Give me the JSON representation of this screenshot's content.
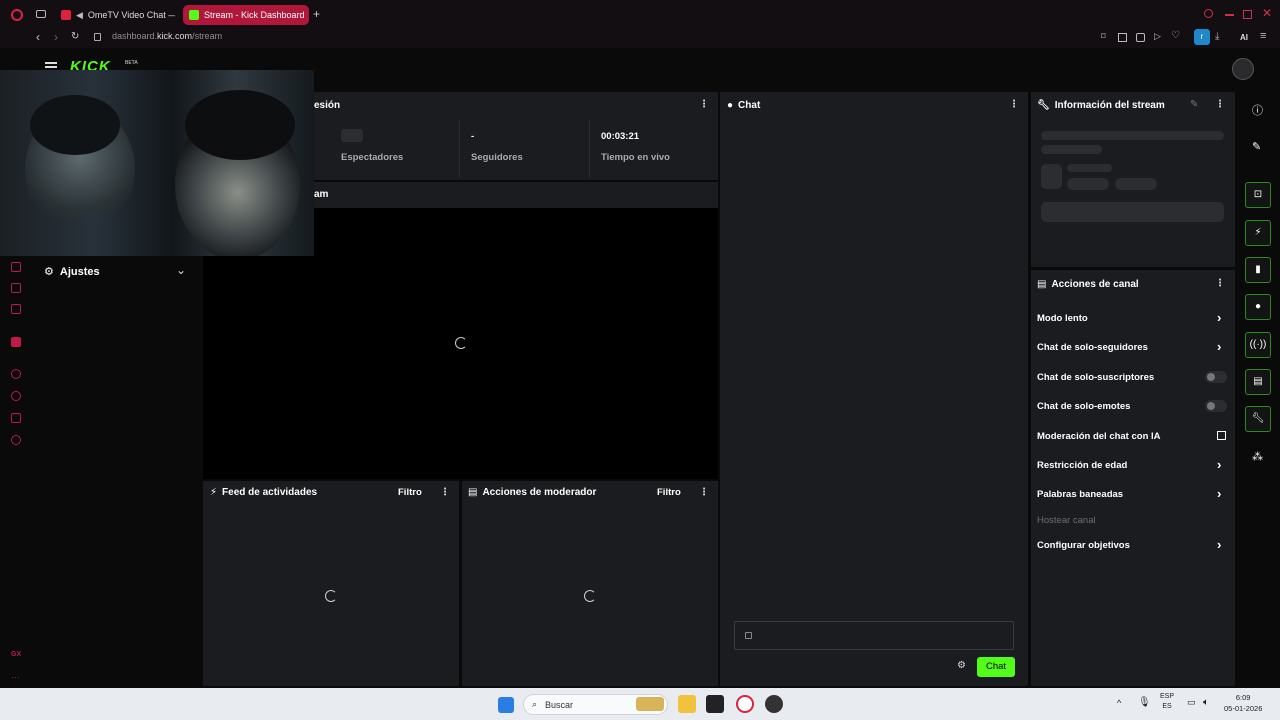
{
  "browser": {
    "tabs": [
      {
        "label": "OmeTV Video Chat —"
      },
      {
        "label": "Stream - Kick Dashboard"
      }
    ],
    "new_tab": "+",
    "url_prefix": "dashboard.",
    "url_domain": "kick.com",
    "url_path": "/stream",
    "ai_label": "AI"
  },
  "kick": {
    "logo_text": "KICK",
    "beta": "BETA"
  },
  "session": {
    "title_partial": "esión",
    "stats": [
      {
        "label": "Espectadores",
        "value": ""
      },
      {
        "label": "Seguidores",
        "value": "-"
      },
      {
        "label": "Tiempo en vivo",
        "value": "00:03:21"
      }
    ]
  },
  "stream_header": "am",
  "sidebar": {
    "settings_label": "Ajustes"
  },
  "chat": {
    "title": "Chat",
    "send_label": "Chat"
  },
  "feed": {
    "title": "Feed de actividades",
    "filter": "Filtro"
  },
  "mod_actions": {
    "title": "Acciones de moderador",
    "filter": "Filtro"
  },
  "stream_info": {
    "title": "Información del stream"
  },
  "channel_actions": {
    "title": "Acciones de canal",
    "items": [
      {
        "label": "Modo lento",
        "control": "chevron"
      },
      {
        "label": "Chat de solo-seguidores",
        "control": "chevron"
      },
      {
        "label": "Chat de solo-suscriptores",
        "control": "toggle",
        "enabled": false
      },
      {
        "label": "Chat de solo-emotes",
        "control": "toggle",
        "enabled": false
      },
      {
        "label": "Moderación del chat con IA",
        "control": "external"
      },
      {
        "label": "Restricción de edad",
        "control": "chevron"
      },
      {
        "label": "Palabras baneadas",
        "control": "chevron"
      },
      {
        "label": "Hostear canal",
        "control": "none",
        "disabled": true
      },
      {
        "label": "Configurar objetivos",
        "control": "chevron"
      }
    ]
  },
  "taskbar": {
    "search_placeholder": "Buscar",
    "lang": "ESP",
    "region": "ES",
    "time": "6:09",
    "date": "05-01-2026"
  },
  "colors": {
    "accent": "#53fc18",
    "tab_active": "#b0173a",
    "sidebar_icon": "#c0184a",
    "panel": "#1b1c1f"
  }
}
